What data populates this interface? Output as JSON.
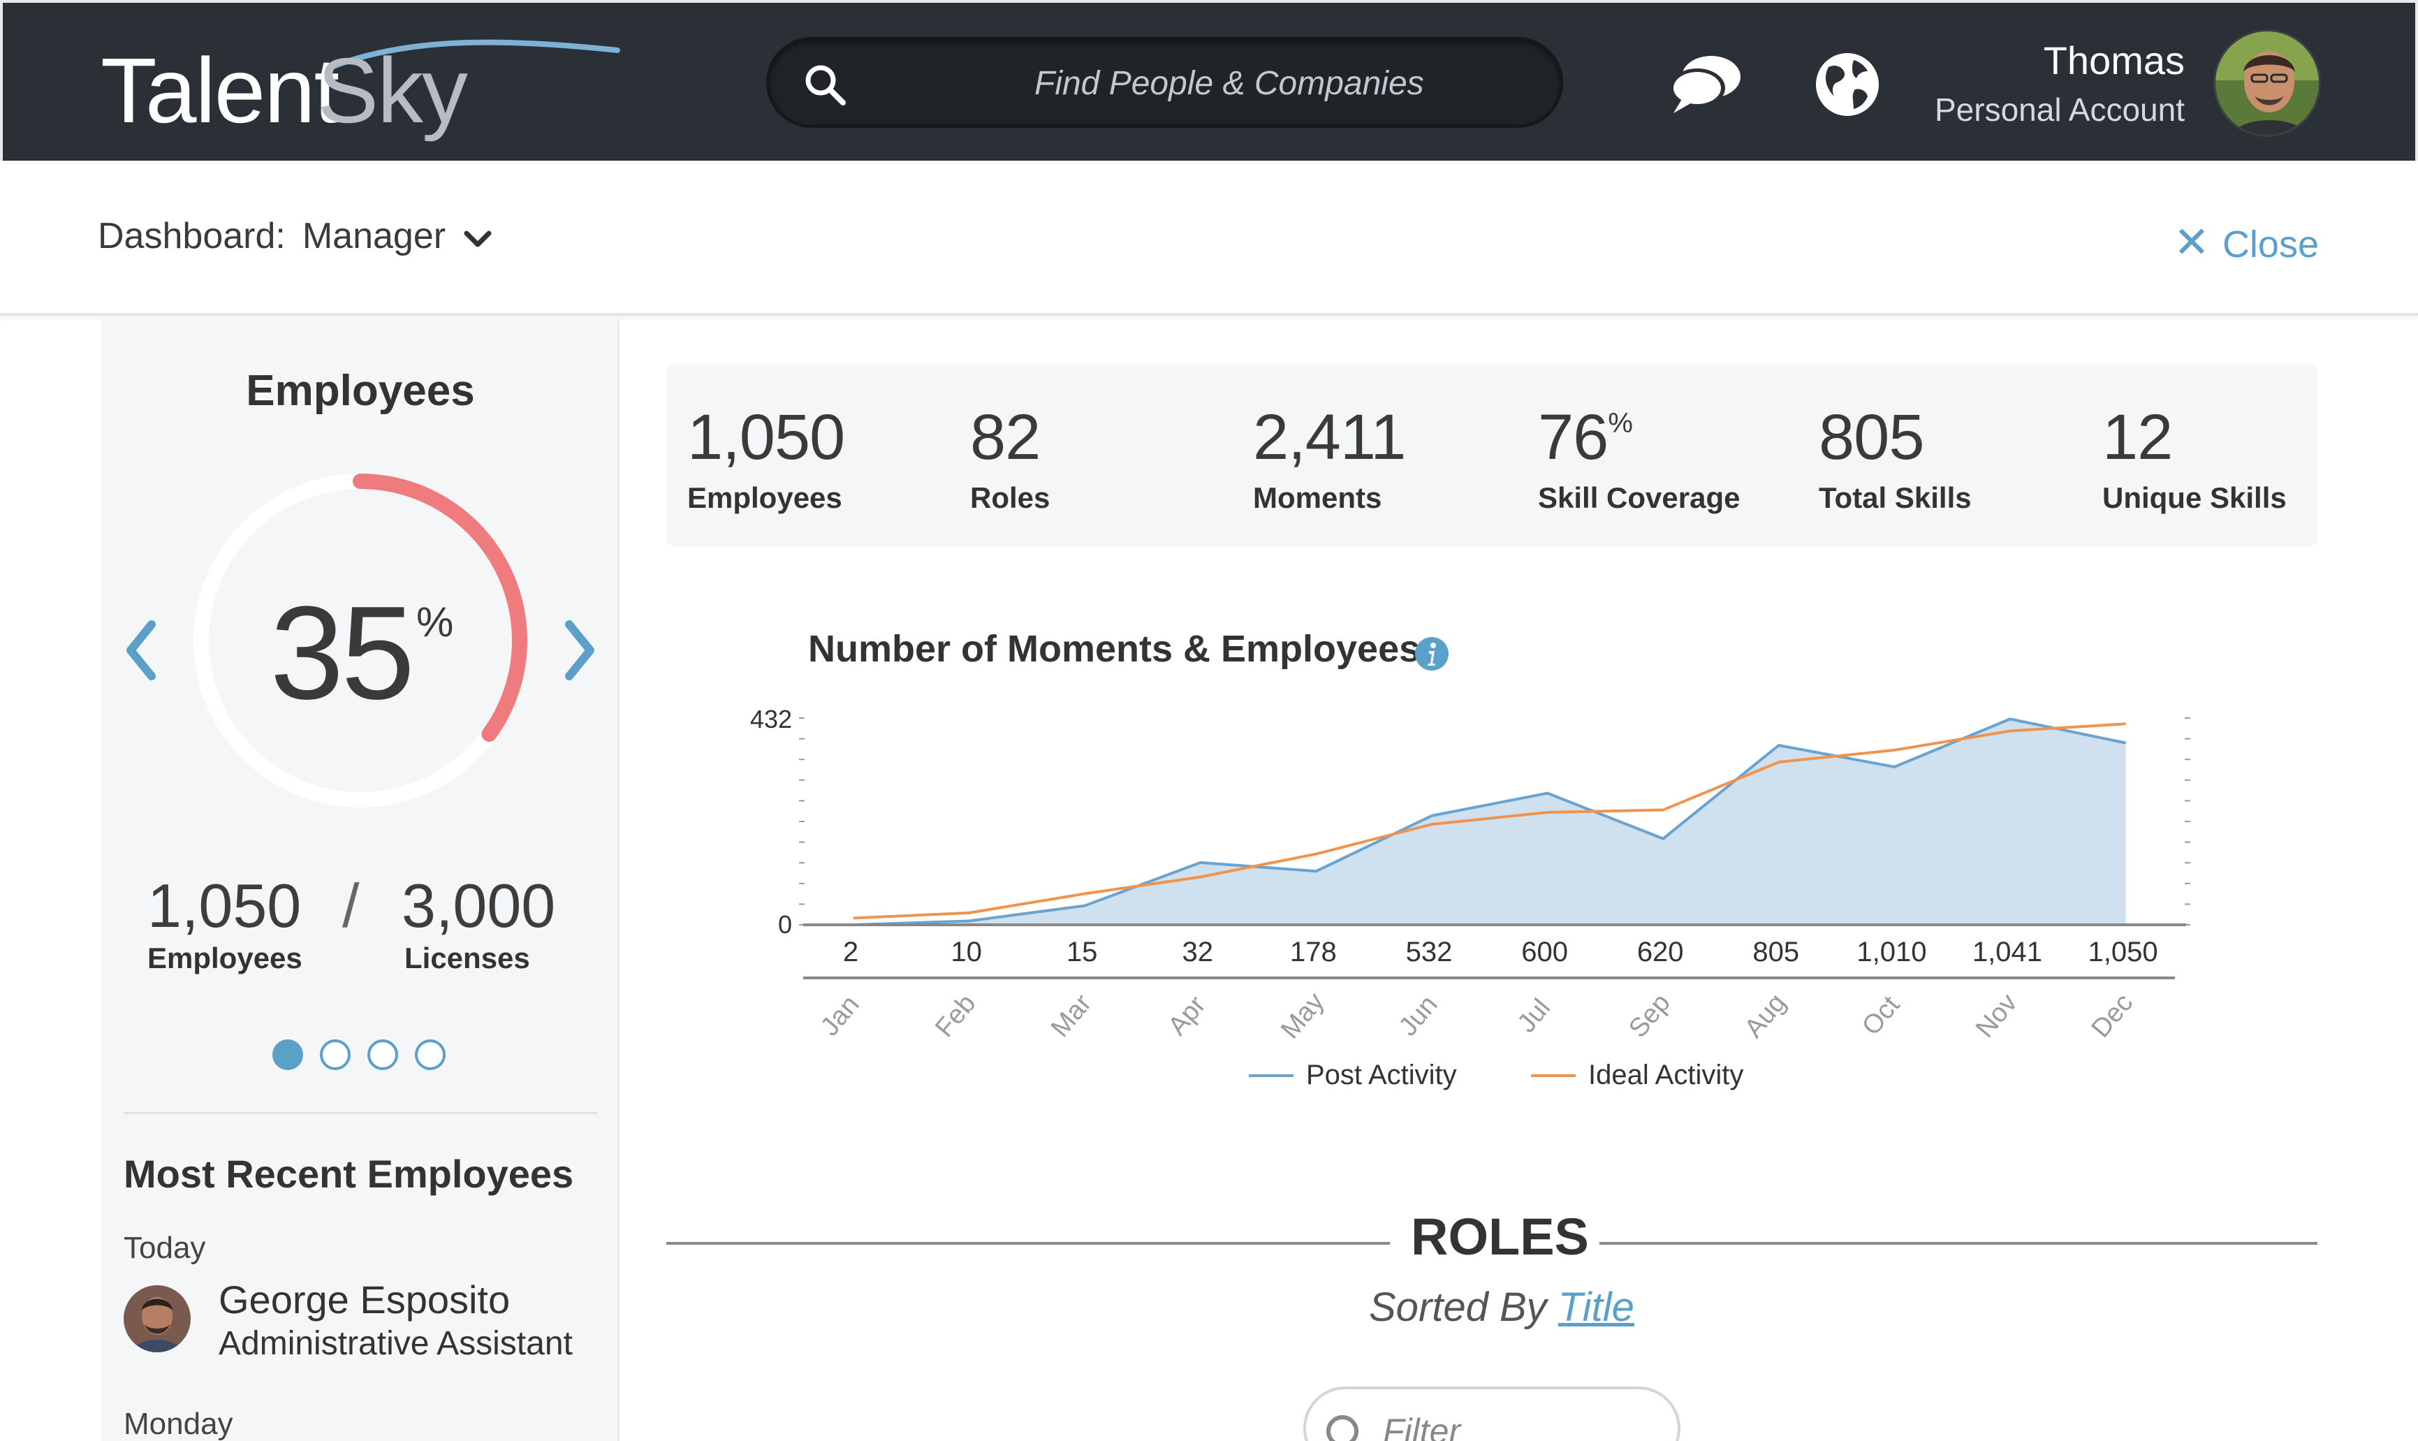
{
  "app": {
    "logo_primary": "Talent",
    "logo_secondary": "Sky"
  },
  "header": {
    "search_placeholder": "Find People & Companies",
    "icons": [
      "search-icon",
      "chat-bubbles-icon",
      "globe-icon"
    ],
    "user": {
      "name": "Thomas",
      "account_type": "Personal Account"
    }
  },
  "subheader": {
    "dashboard_label": "Dashboard:",
    "dashboard_value": "Manager",
    "close_label": "Close"
  },
  "left_panel": {
    "title": "Employees",
    "percent_value": "35",
    "percent_symbol": "%",
    "percent_fraction": 0.35,
    "employees_count": "1,050",
    "employees_label": "Employees",
    "separator": "/",
    "licenses_count": "3,000",
    "licenses_label": "Licenses",
    "pager": {
      "total": 4,
      "active_index": 0
    },
    "recent_title": "Most Recent Employees",
    "recent": [
      {
        "day": "Today",
        "name": "George Esposito",
        "role": "Administrative Assistant"
      },
      {
        "day": "Monday"
      }
    ]
  },
  "stats": [
    {
      "value": "1,050",
      "label": "Employees"
    },
    {
      "value": "82",
      "label": "Roles"
    },
    {
      "value": "2,411",
      "label": "Moments"
    },
    {
      "value": "76",
      "suffix": "%",
      "label": "Skill Coverage"
    },
    {
      "value": "805",
      "label": "Total Skills"
    },
    {
      "value": "12",
      "label": "Unique Skills"
    }
  ],
  "chart_data": {
    "type": "area",
    "title": "Number of Moments & Employees",
    "categories": [
      "Jan",
      "Feb",
      "Mar",
      "Apr",
      "May",
      "Jun",
      "Jul",
      "Sep",
      "Aug",
      "Oct",
      "Nov",
      "Dec"
    ],
    "employee_counts": [
      "2",
      "10",
      "15",
      "32",
      "178",
      "532",
      "600",
      "620",
      "805",
      "1,010",
      "1,041",
      "1,050"
    ],
    "ylim": [
      0,
      432
    ],
    "y_tick_labels": [
      "0",
      "432"
    ],
    "series": [
      {
        "name": "Post Activity",
        "kind": "area",
        "color": "#6aa3cf",
        "fill": "#cfe1ee",
        "values": [
          0,
          8,
          40,
          130,
          112,
          228,
          275,
          180,
          375,
          330,
          430,
          380
        ]
      },
      {
        "name": "Ideal Activity",
        "kind": "line",
        "color": "#f0944d",
        "values": [
          14,
          25,
          65,
          100,
          148,
          210,
          235,
          240,
          340,
          365,
          405,
          420
        ]
      }
    ],
    "legend_position": "bottom"
  },
  "roles": {
    "title": "ROLES",
    "sorted_prefix": "Sorted By",
    "sorted_by": "Title",
    "filter_placeholder": "Filter"
  },
  "colors": {
    "header_bg": "#2b2f36",
    "accent": "#5aa0c9",
    "gauge": "#f07b7e"
  }
}
